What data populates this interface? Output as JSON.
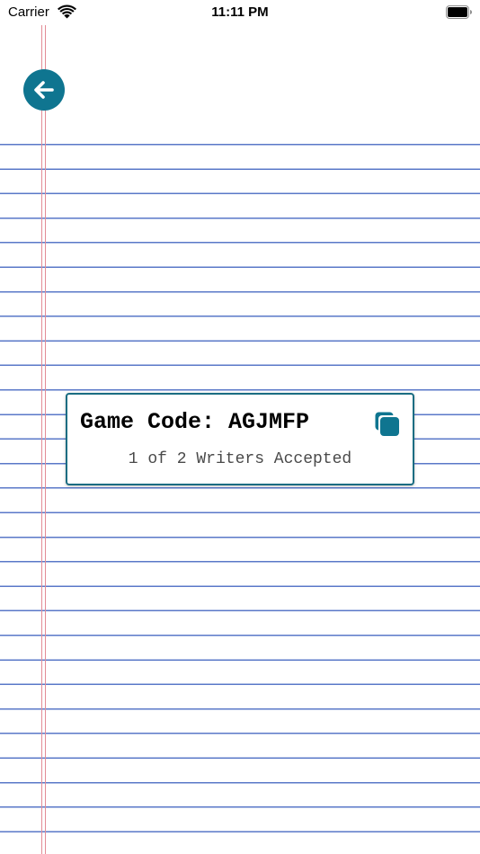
{
  "status_bar": {
    "carrier": "Carrier",
    "time": "11:11 PM",
    "wifi_icon": "wifi-icon",
    "battery_icon": "battery-full-icon"
  },
  "nav": {
    "back_icon": "arrow-left-icon"
  },
  "game_code_card": {
    "title_label": "Game Code:",
    "code": "AGJMFP",
    "title_text": "Game Code: AGJMFP",
    "copy_icon": "copy-icon",
    "writers_status": "1 of 2 Writers Accepted"
  },
  "colors": {
    "accent": "#0f7590",
    "card_border": "#1a6d82",
    "ruled_line": "#5a78c8",
    "margin_line": "#e38c96"
  }
}
